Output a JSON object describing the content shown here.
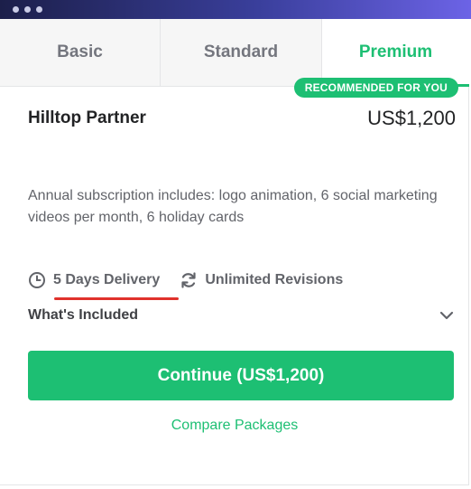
{
  "window": {
    "controls": [
      "dot",
      "dot",
      "dot"
    ]
  },
  "tabs": [
    {
      "label": "Basic",
      "active": false
    },
    {
      "label": "Standard",
      "active": false
    },
    {
      "label": "Premium",
      "active": true
    }
  ],
  "package": {
    "badge": "RECOMMENDED FOR YOU",
    "title": "Hilltop Partner",
    "price": "US$1,200",
    "description": "Annual subscription includes: logo animation, 6 social marketing videos per month, 6 holiday cards",
    "delivery": {
      "icon": "clock-icon",
      "label": "5 Days Delivery"
    },
    "revisions": {
      "icon": "refresh-icon",
      "label": "Unlimited Revisions"
    },
    "whats_included": {
      "label": "What's Included",
      "icon": "chevron-down-icon"
    }
  },
  "actions": {
    "continue_label": "Continue (US$1,200)",
    "compare_label": "Compare Packages"
  },
  "colors": {
    "accent": "#1dbf73",
    "annotation_underline": "#e0322c",
    "titlebar_start": "#1c1f4a",
    "titlebar_end": "#6c63e6"
  }
}
